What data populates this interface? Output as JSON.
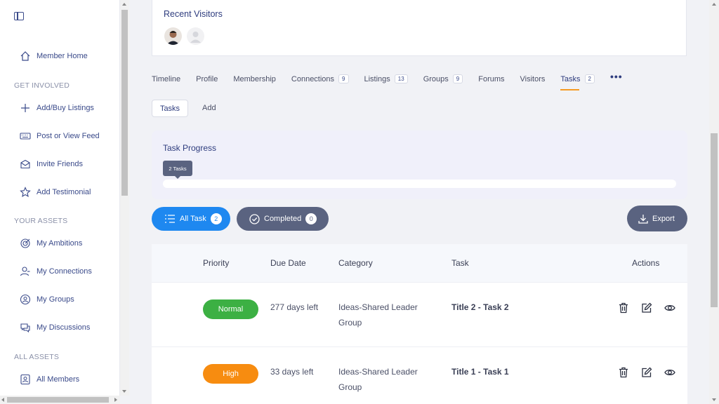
{
  "sidebar": {
    "member_home": "Member Home",
    "sections": {
      "get_involved": "GET INVOLVED",
      "your_assets": "YOUR ASSETS",
      "all_assets": "ALL ASSETS"
    },
    "items": {
      "add_buy_listings": "Add/Buy Listings",
      "post_view_feed": "Post or View Feed",
      "invite_friends": "Invite Friends",
      "add_testimonial": "Add Testimonial",
      "my_ambitions": "My Ambitions",
      "my_connections": "My Connections",
      "my_groups": "My Groups",
      "my_discussions": "My Discussions",
      "all_members": "All Members"
    }
  },
  "visitors": {
    "title": "Recent Visitors"
  },
  "tabs": [
    {
      "label": "Timeline",
      "count": ""
    },
    {
      "label": "Profile",
      "count": ""
    },
    {
      "label": "Membership",
      "count": ""
    },
    {
      "label": "Connections",
      "count": "9"
    },
    {
      "label": "Listings",
      "count": "13"
    },
    {
      "label": "Groups",
      "count": "9"
    },
    {
      "label": "Forums",
      "count": ""
    },
    {
      "label": "Visitors",
      "count": ""
    },
    {
      "label": "Tasks",
      "count": "2"
    }
  ],
  "subtabs": {
    "active": "Tasks",
    "add": "Add"
  },
  "progress": {
    "title": "Task Progress",
    "tooltip": "2 Tasks",
    "completed_fraction": 0
  },
  "filters": {
    "all_label": "All Task",
    "all_count": "2",
    "completed_label": "Completed",
    "completed_count": "0",
    "export_label": "Export"
  },
  "table": {
    "headers": {
      "priority": "Priority",
      "due": "Due Date",
      "category": "Category",
      "task": "Task",
      "actions": "Actions"
    },
    "rows": [
      {
        "priority": "Normal",
        "priority_color": "#3cb043",
        "due": "277 days left",
        "category": "Ideas-Shared Leader Group",
        "task": "Title 2 - Task 2"
      },
      {
        "priority": "High",
        "priority_color": "#f78c10",
        "due": "33 days left",
        "category": "Ideas-Shared Leader Group",
        "task": "Title 1 - Task 1"
      }
    ]
  },
  "colors": {
    "accent": "#1e88f0",
    "nav": "#2e3c7e",
    "tab_underline": "#f59a23",
    "secondary_button": "#5a6380"
  }
}
